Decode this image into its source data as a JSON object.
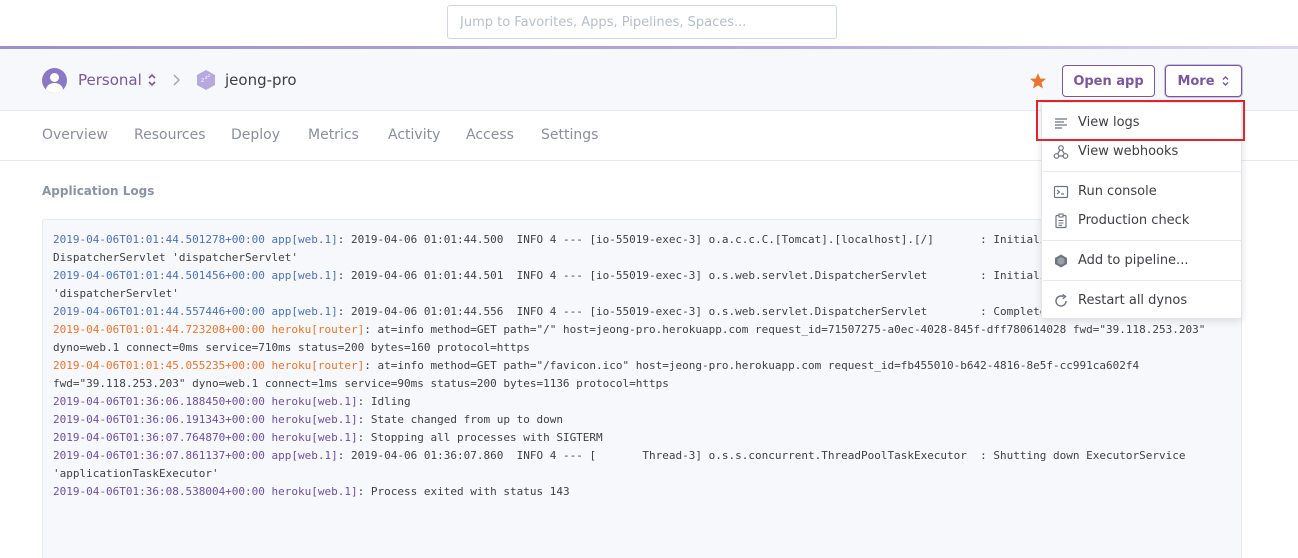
{
  "search": {
    "placeholder": "Jump to Favorites, Apps, Pipelines, Spaces..."
  },
  "header": {
    "account": "Personal",
    "app_name": "jeong-pro",
    "open_app_label": "Open app",
    "more_label": "More",
    "favorite_color": "#e8742f",
    "accent_color": "#79589f"
  },
  "tabs": [
    {
      "label": "Overview"
    },
    {
      "label": "Resources"
    },
    {
      "label": "Deploy"
    },
    {
      "label": "Metrics"
    },
    {
      "label": "Activity"
    },
    {
      "label": "Access"
    },
    {
      "label": "Settings"
    }
  ],
  "logs": {
    "title": "Application Logs",
    "lines": [
      {
        "ts": "2019-04-06T01:01:44.501278+00:00",
        "src": "app[web.1]",
        "kind": "blue",
        "msg": ": 2019-04-06 01:01:44.500  INFO 4 --- [io-55019-exec-3] o.a.c.c.C.[Tomcat].[localhost].[/]       : Initiali"
      },
      {
        "cont": "DispatcherServlet 'dispatcherServlet'"
      },
      {
        "ts": "2019-04-06T01:01:44.501456+00:00",
        "src": "app[web.1]",
        "kind": "blue",
        "msg": ": 2019-04-06 01:01:44.501  INFO 4 --- [io-55019-exec-3] o.s.web.servlet.DispatcherServlet        : Initiali"
      },
      {
        "cont": "'dispatcherServlet'"
      },
      {
        "ts": "2019-04-06T01:01:44.557446+00:00",
        "src": "app[web.1]",
        "kind": "blue",
        "msg": ": 2019-04-06 01:01:44.556  INFO 4 --- [io-55019-exec-3] o.s.web.servlet.DispatcherServlet        : Complete"
      },
      {
        "ts": "2019-04-06T01:01:44.723208+00:00",
        "src": "heroku[router]",
        "kind": "orange",
        "msg": ": at=info method=GET path=\"/\" host=jeong-pro.herokuapp.com request_id=71507275-a0ec-4028-845f-dff780614028 fwd=\"39.118.253.203\""
      },
      {
        "cont": "dyno=web.1 connect=0ms service=710ms status=200 bytes=160 protocol=https"
      },
      {
        "ts": "2019-04-06T01:01:45.055235+00:00",
        "src": "heroku[router]",
        "kind": "orange",
        "msg": ": at=info method=GET path=\"/favicon.ico\" host=jeong-pro.herokuapp.com request_id=fb455010-b642-4816-8e5f-cc991ca602f4"
      },
      {
        "cont": "fwd=\"39.118.253.203\" dyno=web.1 connect=1ms service=90ms status=200 bytes=1136 protocol=https"
      },
      {
        "ts": "2019-04-06T01:36:06.188450+00:00",
        "src": "heroku[web.1]",
        "kind": "purple",
        "msg": ": Idling"
      },
      {
        "ts": "2019-04-06T01:36:06.191343+00:00",
        "src": "heroku[web.1]",
        "kind": "purple",
        "msg": ": State changed from up to down"
      },
      {
        "ts": "2019-04-06T01:36:07.764870+00:00",
        "src": "heroku[web.1]",
        "kind": "purple",
        "msg": ": Stopping all processes with SIGTERM"
      },
      {
        "ts": "2019-04-06T01:36:07.861137+00:00",
        "src": "app[web.1]",
        "kind": "purple",
        "msg": ": 2019-04-06 01:36:07.860  INFO 4 --- [       Thread-3] o.s.s.concurrent.ThreadPoolTaskExecutor  : Shutting down ExecutorService"
      },
      {
        "cont": "'applicationTaskExecutor'"
      },
      {
        "ts": "2019-04-06T01:36:08.538004+00:00",
        "src": "heroku[web.1]",
        "kind": "purple",
        "msg": ": Process exited with status 143"
      }
    ]
  },
  "more_menu": {
    "items": [
      {
        "label": "View logs",
        "icon": "list-icon"
      },
      {
        "label": "View webhooks",
        "icon": "webhook-icon"
      },
      {
        "label": "Run console",
        "icon": "console-icon"
      },
      {
        "label": "Production check",
        "icon": "clipboard-icon"
      },
      {
        "label": "Add to pipeline...",
        "icon": "pipeline-icon"
      },
      {
        "label": "Restart all dynos",
        "icon": "restart-icon"
      }
    ],
    "highlight_color": "#e0242b"
  }
}
